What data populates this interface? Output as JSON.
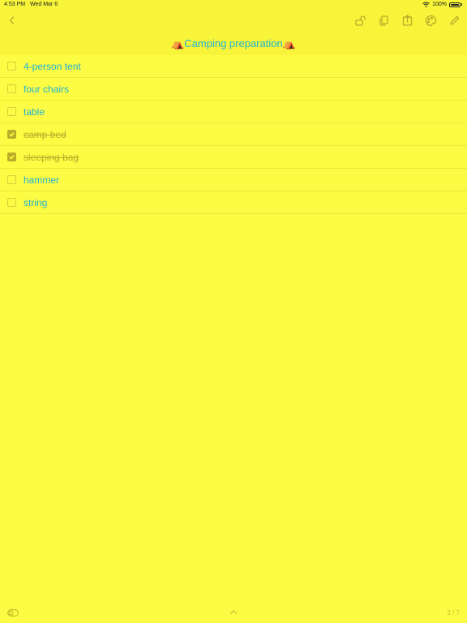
{
  "status": {
    "time": "4:53 PM",
    "date": "Wed Mar 6",
    "battery": "100%"
  },
  "note": {
    "title": "⛺Camping preparation⛺"
  },
  "items": [
    {
      "label": "4-person tent",
      "checked": false
    },
    {
      "label": "four chairs",
      "checked": false
    },
    {
      "label": "table",
      "checked": false
    },
    {
      "label": "camp bed",
      "checked": true
    },
    {
      "label": "sleeping bag",
      "checked": true
    },
    {
      "label": "hammer",
      "checked": false
    },
    {
      "label": "string",
      "checked": false
    }
  ],
  "footer": {
    "page_count": "2 / 7"
  },
  "icons": {
    "back": "chevron-left-icon",
    "lock": "unlock-icon",
    "copy": "duplicate-icon",
    "share": "share-icon",
    "palette": "palette-icon",
    "edit": "pencil-icon",
    "toggle": "toggle-icon",
    "scroll_up": "chevron-up-icon"
  },
  "colors": {
    "background": "#fdfc44",
    "bar": "#f8f43a",
    "text": "#1fb2d0",
    "done": "#b9ad2a"
  }
}
